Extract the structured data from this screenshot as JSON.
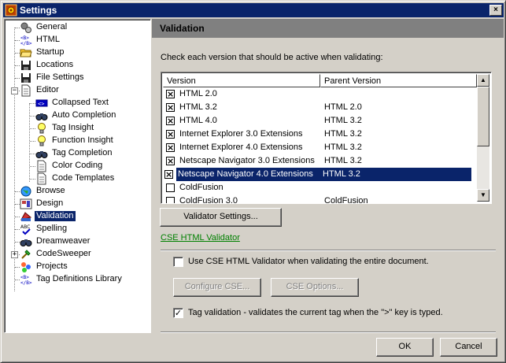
{
  "window": {
    "title": "Settings",
    "close_glyph": "×",
    "app_icon": "settings-app-icon"
  },
  "tree": {
    "items": [
      {
        "label": "General",
        "icon": "gears-icon"
      },
      {
        "label": "HTML",
        "icon": "html-tag-icon"
      },
      {
        "label": "Startup",
        "icon": "folder-open-icon"
      },
      {
        "label": "Locations",
        "icon": "floppy-disk-icon"
      },
      {
        "label": "File Settings",
        "icon": "floppy-disk-icon"
      },
      {
        "label": "Editor",
        "icon": "document-icon"
      },
      {
        "label": "Collapsed Text",
        "icon": "collapsed-text-icon"
      },
      {
        "label": "Auto Completion",
        "icon": "binoculars-icon"
      },
      {
        "label": "Tag Insight",
        "icon": "lightbulb-icon"
      },
      {
        "label": "Function Insight",
        "icon": "lightbulb-icon"
      },
      {
        "label": "Tag Completion",
        "icon": "binoculars-icon"
      },
      {
        "label": "Color Coding",
        "icon": "document-icon"
      },
      {
        "label": "Code Templates",
        "icon": "document-icon"
      },
      {
        "label": "Browse",
        "icon": "globe-icon"
      },
      {
        "label": "Design",
        "icon": "design-icon"
      },
      {
        "label": "Validation",
        "icon": "validation-icon"
      },
      {
        "label": "Spelling",
        "icon": "spelling-icon"
      },
      {
        "label": "Dreamweaver",
        "icon": "binoculars-icon"
      },
      {
        "label": "CodeSweeper",
        "icon": "broom-icon"
      },
      {
        "label": "Projects",
        "icon": "projects-icon"
      },
      {
        "label": "Tag Definitions Library",
        "icon": "html-tag-icon"
      }
    ],
    "selected": "Validation",
    "expander_plus": "+",
    "expander_minus": "−"
  },
  "panel": {
    "title": "Validation",
    "instruction": "Check each version that should be active when validating:",
    "list": {
      "columns": [
        "Version",
        "Parent Version"
      ],
      "rows": [
        {
          "version": "HTML 2.0",
          "parent": "",
          "checked": true
        },
        {
          "version": "HTML 3.2",
          "parent": "HTML 2.0",
          "checked": true
        },
        {
          "version": "HTML 4.0",
          "parent": "HTML 3.2",
          "checked": true
        },
        {
          "version": "Internet Explorer 3.0 Extensions",
          "parent": "HTML 3.2",
          "checked": true
        },
        {
          "version": "Internet Explorer 4.0 Extensions",
          "parent": "HTML 3.2",
          "checked": true
        },
        {
          "version": "Netscape Navigator 3.0 Extensions",
          "parent": "HTML 3.2",
          "checked": true
        },
        {
          "version": "Netscape Navigator 4.0 Extensions",
          "parent": "HTML 3.2",
          "checked": true,
          "selected": true
        },
        {
          "version": "ColdFusion",
          "parent": "",
          "checked": false
        },
        {
          "version": "ColdFusion 3.0",
          "parent": "ColdFusion",
          "checked": false
        }
      ],
      "check_glyph": "×",
      "scroll_up": "▲",
      "scroll_down": "▼"
    },
    "validator_settings_button": "Validator Settings...",
    "cse_link": "CSE HTML Validator",
    "use_cse": {
      "label": "Use CSE HTML Validator when validating the entire document.",
      "checked": false
    },
    "configure_cse_button": "Configure CSE...",
    "cse_options_button": "CSE Options...",
    "tag_validation": {
      "label": "Tag validation - validates the current tag when the \">\" key is typed.",
      "checked": true
    },
    "check_mark": "✓"
  },
  "footer": {
    "ok_label": "OK",
    "cancel_label": "Cancel"
  }
}
